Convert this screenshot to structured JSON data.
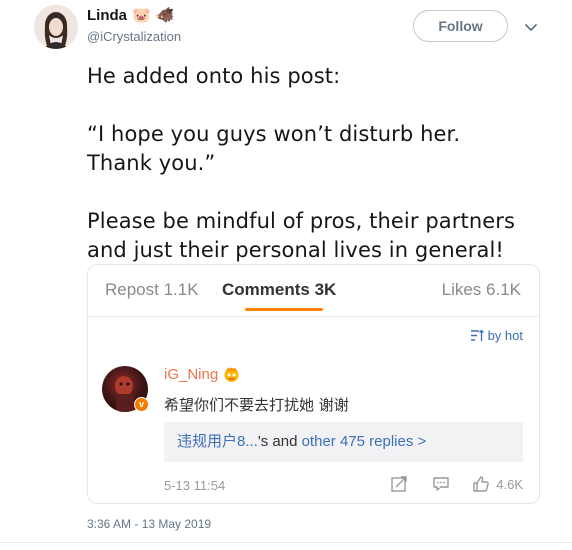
{
  "author": {
    "name": "Linda",
    "emojis": [
      "🐷",
      "🐗"
    ],
    "handle": "@iCrystalization",
    "follow_label": "Follow"
  },
  "tweet": {
    "paragraphs": [
      "He added onto his post:",
      "“I hope you guys won’t disturb her.",
      "Thank you.”",
      "Please be mindful of pros, their partners",
      "and just their personal lives in general!"
    ],
    "timestamp": "3:36 AM - 13 May 2019"
  },
  "weibo_card": {
    "tabs": {
      "repost": "Repost 1.1K",
      "comments": "Comments 3K",
      "likes": "Likes 6.1K"
    },
    "sort_label": "by hot",
    "comment": {
      "user": "iG_Ning",
      "text": "希望你们不要去打扰她 谢谢",
      "replies_user": "违规用户8...",
      "replies_mid": "'s and ",
      "replies_link": "other 475 replies >",
      "date": "5-13 11:54",
      "like_count": "4.6K"
    }
  },
  "colors": {
    "accent_orange": "#ff8200",
    "link_blue": "#3b6fb6",
    "username_orange": "#eb7350"
  },
  "icons": [
    "chevron-down-icon",
    "sort-icon",
    "repost-icon",
    "comment-icon",
    "like-icon",
    "verified-icon",
    "user-badge-icon"
  ]
}
